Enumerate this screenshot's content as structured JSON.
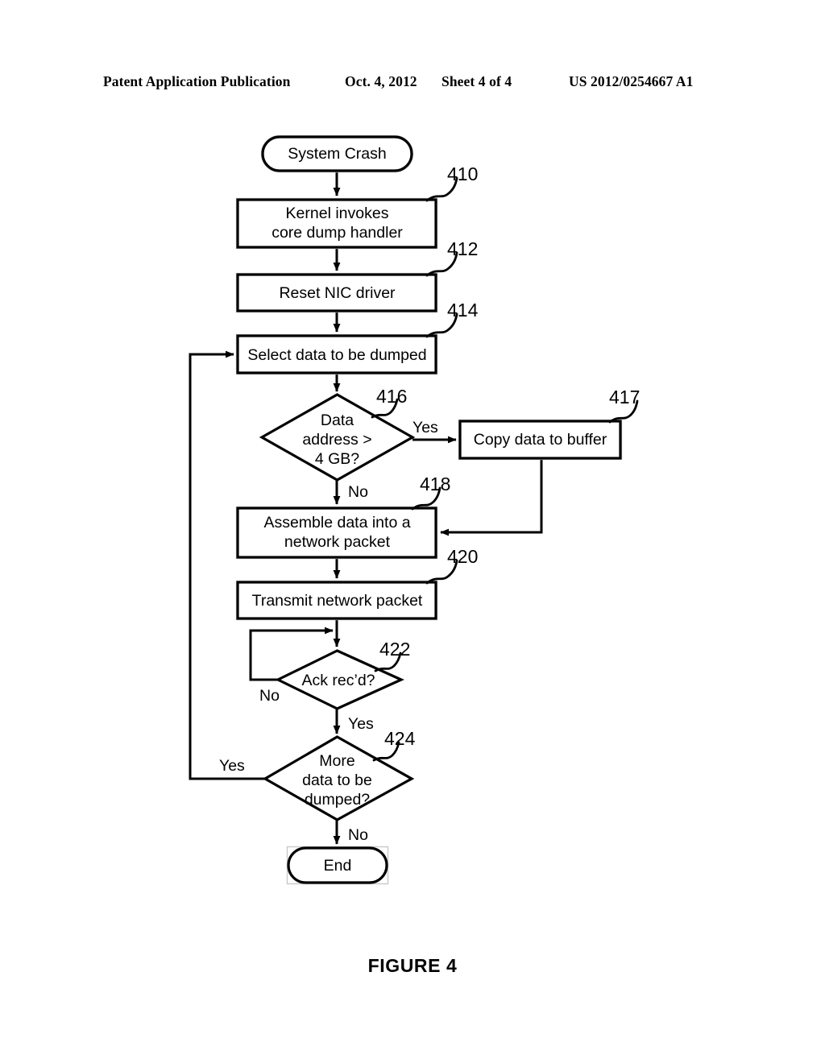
{
  "header": {
    "publication": "Patent Application Publication",
    "date": "Oct. 4, 2012",
    "sheet": "Sheet 4 of 4",
    "patent_number": "US 2012/0254667 A1"
  },
  "figure": {
    "caption": "FIGURE 4"
  },
  "chart_data": {
    "type": "flowchart",
    "title": "FIGURE 4",
    "nodes": [
      {
        "id": "start",
        "shape": "terminator",
        "label": "System Crash",
        "ref": null
      },
      {
        "id": "n410",
        "shape": "process",
        "label": "Kernel invokes core dump handler",
        "ref": "410"
      },
      {
        "id": "n412",
        "shape": "process",
        "label": "Reset NIC driver",
        "ref": "412"
      },
      {
        "id": "n414",
        "shape": "process",
        "label": "Select data to be dumped",
        "ref": "414"
      },
      {
        "id": "n416",
        "shape": "decision",
        "label": "Data address > 4 GB?",
        "ref": "416"
      },
      {
        "id": "n417",
        "shape": "process",
        "label": "Copy data to buffer",
        "ref": "417"
      },
      {
        "id": "n418",
        "shape": "process",
        "label": "Assemble data into a network packet",
        "ref": "418"
      },
      {
        "id": "n420",
        "shape": "process",
        "label": "Transmit network packet",
        "ref": "420"
      },
      {
        "id": "n422",
        "shape": "decision",
        "label": "Ack rec'd?",
        "ref": "422"
      },
      {
        "id": "n424",
        "shape": "decision",
        "label": "More data to be dumped?",
        "ref": "424"
      },
      {
        "id": "end",
        "shape": "terminator",
        "label": "End",
        "ref": null
      }
    ],
    "edges": [
      {
        "from": "start",
        "to": "n410",
        "label": ""
      },
      {
        "from": "n410",
        "to": "n412",
        "label": ""
      },
      {
        "from": "n412",
        "to": "n414",
        "label": ""
      },
      {
        "from": "n414",
        "to": "n416",
        "label": ""
      },
      {
        "from": "n416",
        "to": "n417",
        "label": "Yes"
      },
      {
        "from": "n416",
        "to": "n418",
        "label": "No"
      },
      {
        "from": "n417",
        "to": "n418",
        "label": ""
      },
      {
        "from": "n418",
        "to": "n420",
        "label": ""
      },
      {
        "from": "n420",
        "to": "n422",
        "label": ""
      },
      {
        "from": "n422",
        "to": "n422",
        "label": "No"
      },
      {
        "from": "n422",
        "to": "n424",
        "label": "Yes"
      },
      {
        "from": "n424",
        "to": "n414",
        "label": "Yes"
      },
      {
        "from": "n424",
        "to": "end",
        "label": "No"
      }
    ]
  },
  "nodes": {
    "start": {
      "label": "System Crash"
    },
    "n410": {
      "label_line1": "Kernel invokes",
      "label_line2": "core dump handler",
      "ref": "410"
    },
    "n412": {
      "label": "Reset NIC driver",
      "ref": "412"
    },
    "n414": {
      "label": "Select data to be dumped",
      "ref": "414"
    },
    "n416": {
      "label_line1": "Data",
      "label_line2": "address >",
      "label_line3": "4 GB?",
      "ref": "416"
    },
    "n417": {
      "label": "Copy data to buffer",
      "ref": "417"
    },
    "n418": {
      "label_line1": "Assemble data into a",
      "label_line2": "network packet",
      "ref": "418"
    },
    "n420": {
      "label": "Transmit network packet",
      "ref": "420"
    },
    "n422": {
      "label": "Ack rec’d?",
      "ref": "422"
    },
    "n424": {
      "label_line1": "More",
      "label_line2": "data to be",
      "label_line3": "dumped?",
      "ref": "424"
    },
    "end": {
      "label": "End"
    }
  },
  "branch_labels": {
    "d416_yes": "Yes",
    "d416_no": "No",
    "d422_no": "No",
    "d422_yes": "Yes",
    "d424_yes": "Yes",
    "d424_no": "No"
  },
  "colors": {
    "ink": "#000000",
    "paper": "#ffffff",
    "scan_edge": "#c9c9c9"
  }
}
